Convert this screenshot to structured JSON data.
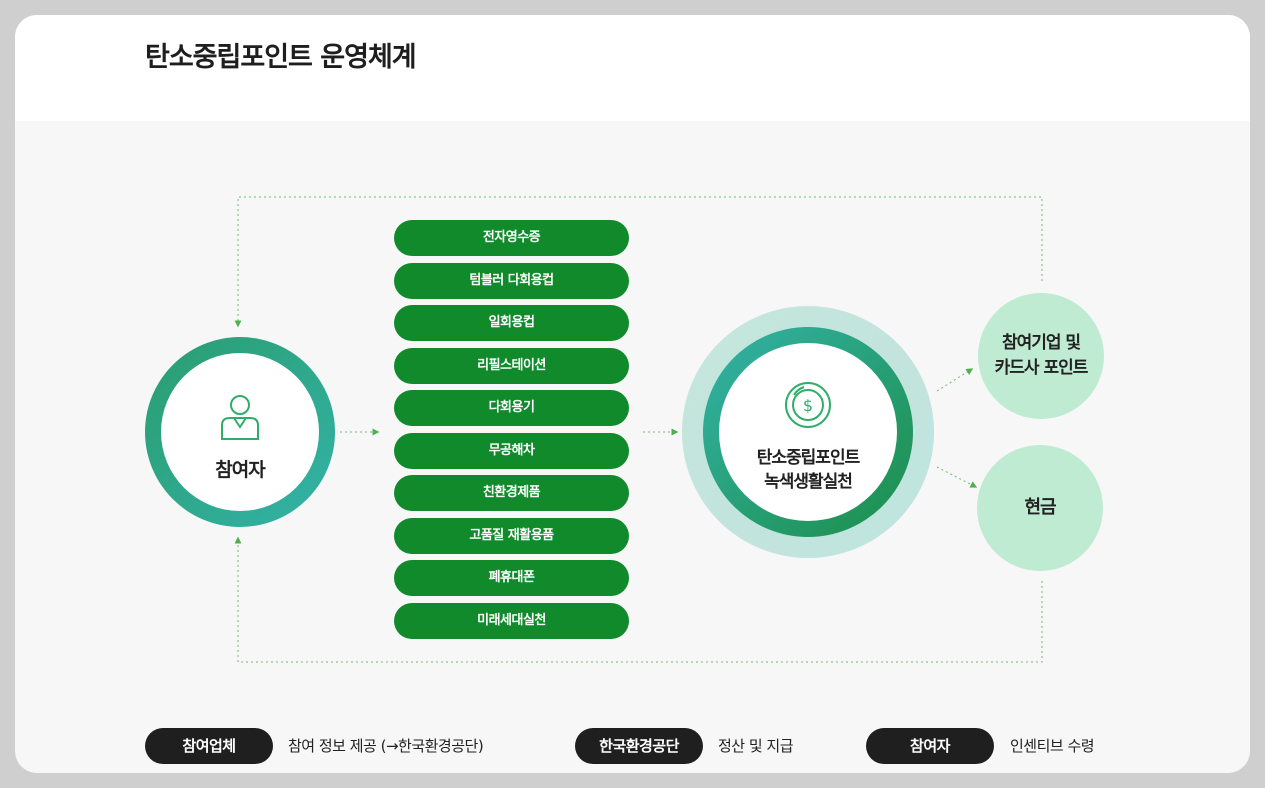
{
  "title": "탄소중립포인트 운영체계",
  "participant": {
    "label": "참여자",
    "icon": "user-icon"
  },
  "activities": [
    "전자영수증",
    "텀블러 다회용컵",
    "일회용컵",
    "리필스테이션",
    "다회용기",
    "무공해차",
    "친환경제품",
    "고품질 재활용품",
    "폐휴대폰",
    "미래세대실천"
  ],
  "hub": {
    "line1": "탄소중립포인트",
    "line2": "녹색생활실천",
    "icon": "coin-icon"
  },
  "rewards": {
    "card_points": {
      "line1": "참여기업 및",
      "line2": "카드사 포인트"
    },
    "cash": "현금"
  },
  "legend": [
    {
      "badge": "참여업체",
      "text": "참여 정보 제공 (→한국환경공단)"
    },
    {
      "badge": "한국환경공단",
      "text": "정산 및 지급"
    },
    {
      "badge": "참여자",
      "text": "인센티브 수령"
    }
  ],
  "colors": {
    "activity_green": "#118a2c",
    "ring_teal": "#33b3a8",
    "ring_green": "#1c8d48",
    "reward_mint": "#bfebd2",
    "legend_dark": "#1f1f1f",
    "connector": "#4caf50"
  }
}
